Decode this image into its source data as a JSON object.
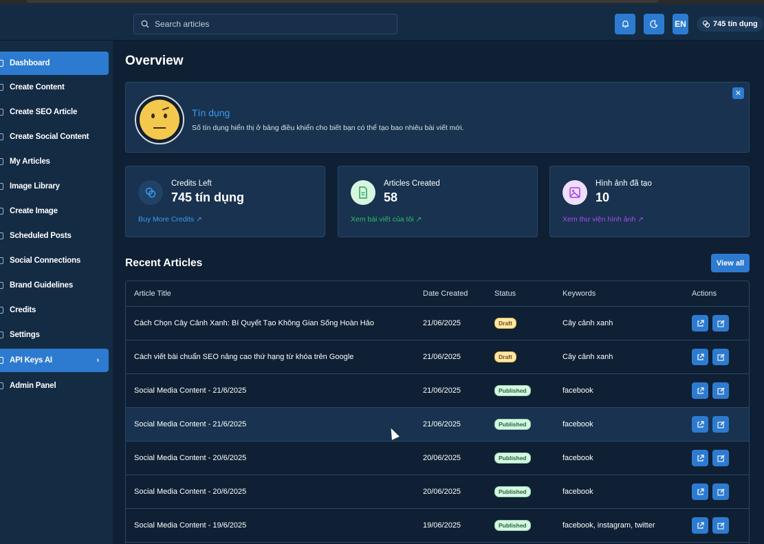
{
  "header": {
    "search_placeholder": "Search articles",
    "lang_label": "EN",
    "credits_label": "745 tín dụng"
  },
  "sidebar": {
    "items": [
      {
        "label": "Dashboard",
        "active": true
      },
      {
        "label": "Create Content"
      },
      {
        "label": "Create SEO Article"
      },
      {
        "label": "Create Social Content"
      },
      {
        "label": "My Articles"
      },
      {
        "label": "Image Library"
      },
      {
        "label": "Create Image"
      },
      {
        "label": "Scheduled Posts"
      },
      {
        "label": "Social Connections"
      },
      {
        "label": "Brand Guidelines"
      },
      {
        "label": "Credits"
      },
      {
        "label": "Settings"
      },
      {
        "label": "API Keys AI",
        "active": true,
        "has_submenu": true
      },
      {
        "label": "Admin Panel"
      }
    ]
  },
  "main": {
    "title": "Overview",
    "banner": {
      "title": "Tín dụng",
      "text": "Số tín dụng hiển thị ở bảng điều khiển cho biết bạn có thể tạo bao nhiêu bài viết mới."
    },
    "stats": [
      {
        "label": "Credits Left",
        "value": "745 tín dụng",
        "link": "Buy More Credits ↗",
        "accent": "#3d9bf0"
      },
      {
        "label": "Articles Created",
        "value": "58",
        "link": "Xem bài viết của tôi ↗",
        "accent": "#2fbf6a"
      },
      {
        "label": "Hình ảnh đã tạo",
        "value": "10",
        "link": "Xem thư viện hình ảnh ↗",
        "accent": "#a64cf0"
      }
    ],
    "recent_title": "Recent Articles",
    "view_all_label": "View all",
    "table": {
      "headers": [
        "Article Title",
        "Date Created",
        "Status",
        "Keywords",
        "Actions"
      ],
      "rows": [
        {
          "title": "Cách Chọn Cây Cảnh Xanh: Bí Quyết Tạo Không Gian Sống Hoàn Hảo",
          "date": "21/06/2025",
          "status": "Draft",
          "keywords": "Cây cảnh xanh"
        },
        {
          "title": "Cách viết bài chuẩn SEO nâng cao thứ hạng từ khóa trên Google",
          "date": "21/06/2025",
          "status": "Draft",
          "keywords": "Cây cảnh xanh"
        },
        {
          "title": "Social Media Content - 21/6/2025",
          "date": "21/06/2025",
          "status": "Published",
          "keywords": "facebook"
        },
        {
          "title": "Social Media Content - 21/6/2025",
          "date": "21/06/2025",
          "status": "Published",
          "keywords": "facebook"
        },
        {
          "title": "Social Media Content - 20/6/2025",
          "date": "20/06/2025",
          "status": "Published",
          "keywords": "facebook"
        },
        {
          "title": "Social Media Content - 20/6/2025",
          "date": "20/06/2025",
          "status": "Published",
          "keywords": "facebook"
        },
        {
          "title": "Social Media Content - 19/6/2025",
          "date": "19/06/2025",
          "status": "Published",
          "keywords": "facebook, instagram, twitter"
        }
      ]
    }
  },
  "colors": {
    "primary": "#2d7bd0",
    "background": "#0f2034",
    "panel": "#18324f"
  }
}
